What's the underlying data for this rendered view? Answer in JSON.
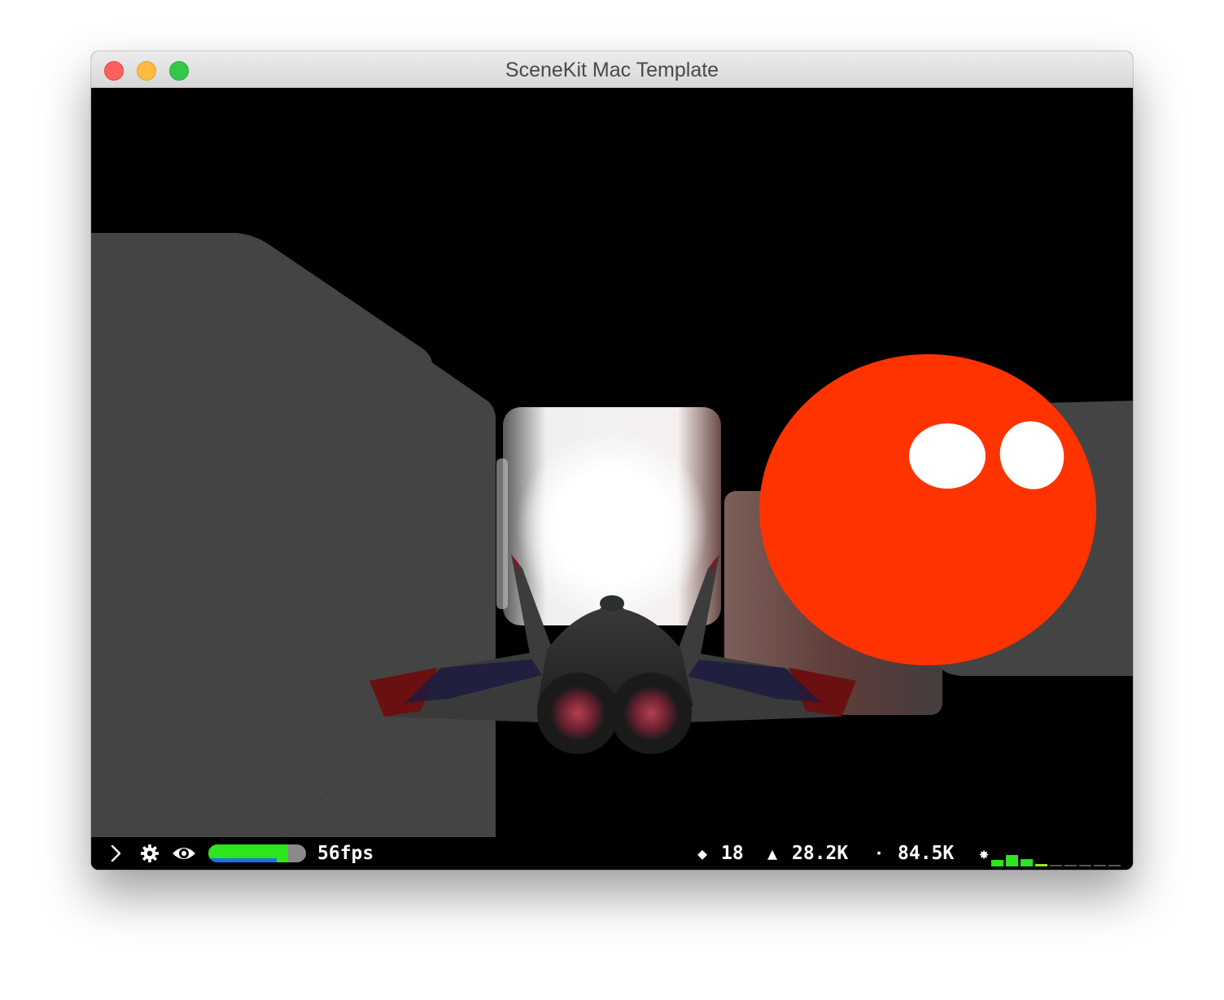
{
  "window": {
    "title": "SceneKit Mac Template"
  },
  "scene": {
    "description_icons": {
      "ship": "spaceship",
      "sphere": "red-sphere",
      "glow": "light-glow"
    },
    "colors": {
      "background": "#000000",
      "block": "#444444",
      "sphere": "#ff3300",
      "highlight": "#ffffff"
    }
  },
  "stats": {
    "expand_icon": "chevron-right-icon",
    "settings_icon": "gear-icon",
    "visibility_icon": "eye-icon",
    "fps_fill": 0.82,
    "fps_label": "56fps",
    "nodes_icon": "diamond-icon",
    "nodes": "18",
    "triangles_icon": "triangle-icon",
    "triangles": "28.2K",
    "vertices_icon": "dot-icon",
    "vertices": "84.5K",
    "perf_icon": "burst-icon",
    "perf_color": "#2be51f"
  }
}
